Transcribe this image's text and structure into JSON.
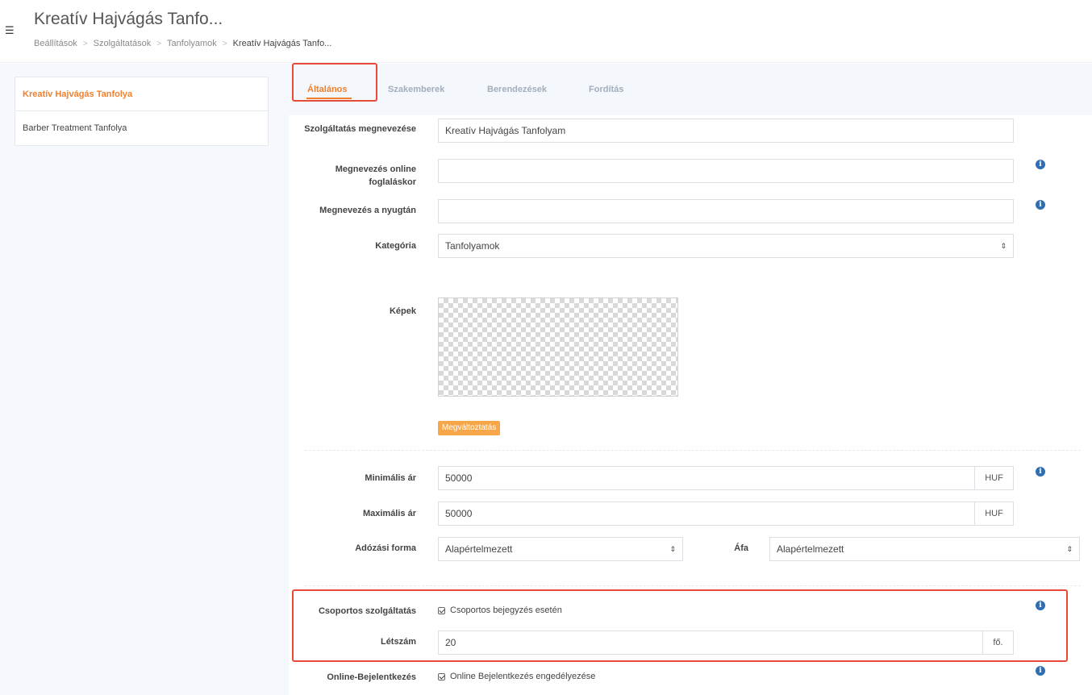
{
  "header": {
    "title": "Kreatív Hajvágás Tanfo...",
    "breadcrumb": [
      "Beállítások",
      "Szolgáltatások",
      "Tanfolyamok",
      "Kreatív Hajvágás Tanfo..."
    ]
  },
  "sidebar": {
    "items": [
      {
        "label": "Kreatív Hajvágás Tanfolya"
      },
      {
        "label": "Barber Treatment Tanfolya"
      }
    ]
  },
  "tabs": [
    {
      "label": "Általános"
    },
    {
      "label": "Szakemberek"
    },
    {
      "label": "Berendezések"
    },
    {
      "label": "Fordítás"
    }
  ],
  "form": {
    "service_name": {
      "label": "Szolgáltatás megnevezése",
      "value": "Kreatív Hajvágás Tanfolyam"
    },
    "online_name": {
      "label": "Megnevezés online foglaláskor",
      "value": ""
    },
    "receipt_name": {
      "label": "Megnevezés a nyugtán",
      "value": ""
    },
    "category": {
      "label": "Kategória",
      "value": "Tanfolyamok"
    },
    "images": {
      "label": "Képek",
      "change_label": "Megváltoztatás"
    },
    "min_price": {
      "label": "Minimális ár",
      "value": "50000",
      "unit": "HUF"
    },
    "max_price": {
      "label": "Maximális ár",
      "value": "50000",
      "unit": "HUF"
    },
    "tax_form": {
      "label": "Adózási forma",
      "value": "Alapértelmezett"
    },
    "vat": {
      "label": "Áfa",
      "value": "Alapértelmezett"
    },
    "group_service": {
      "label": "Csoportos szolgáltatás",
      "checkbox_label": "Csoportos bejegyzés esetén"
    },
    "headcount": {
      "label": "Létszám",
      "value": "20",
      "unit": "fő."
    },
    "online_booking": {
      "label": "Online-Bejelentkezés",
      "checkbox_label": "Online Bejelentkezés engedélyezése"
    }
  },
  "colors": {
    "accent": "#f07f2c",
    "info": "#2f6fb1",
    "highlight": "#e84a3a"
  }
}
